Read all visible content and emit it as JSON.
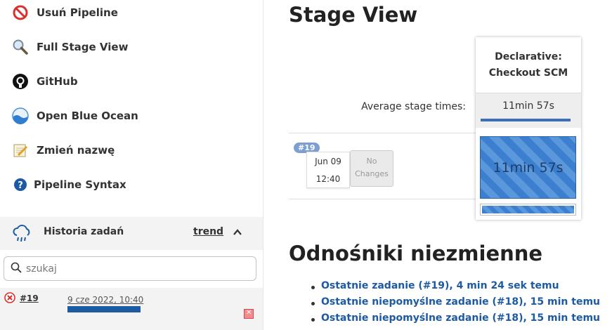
{
  "sidebar": {
    "items": [
      {
        "label": "Usuń Pipeline",
        "icon": "no-entry-icon"
      },
      {
        "label": "Full Stage View",
        "icon": "magnifier-icon"
      },
      {
        "label": "GitHub",
        "icon": "github-icon"
      },
      {
        "label": "Open Blue Ocean",
        "icon": "blue-ocean-icon"
      },
      {
        "label": "Zmień nazwę",
        "icon": "notepad-pencil-icon"
      },
      {
        "label": "Pipeline Syntax",
        "icon": "help-icon"
      }
    ]
  },
  "history": {
    "title": "Historia zadań",
    "trend_label": "trend",
    "search_placeholder": "szukaj",
    "builds": [
      {
        "number": "#19",
        "date": "9 cze 2022, 10:40",
        "status": "failed"
      }
    ]
  },
  "stage_view": {
    "title": "Stage View",
    "avg_label": "Average stage times:",
    "stages": [
      {
        "name": "Declarative: Checkout SCM",
        "avg_time": "11min 57s"
      }
    ],
    "runs": [
      {
        "badge": "#19",
        "date": "Jun 09",
        "time": "12:40",
        "changes_line1": "No",
        "changes_line2": "Changes",
        "cells": [
          "11min 57s"
        ]
      }
    ]
  },
  "permalinks": {
    "title": "Odnośniki niezmienne",
    "links": [
      "Ostatnie zadanie (#19), 4 min 24 sek temu",
      "Ostatnie niepomyślne zadanie (#18), 15 min temu",
      "Ostatnie niepomyślne zadanie (#18), 15 min temu"
    ]
  },
  "colors": {
    "accent": "#1d5aa4",
    "stage_fill": "#3c7fcf",
    "panel_bg": "#f3f3f3"
  }
}
